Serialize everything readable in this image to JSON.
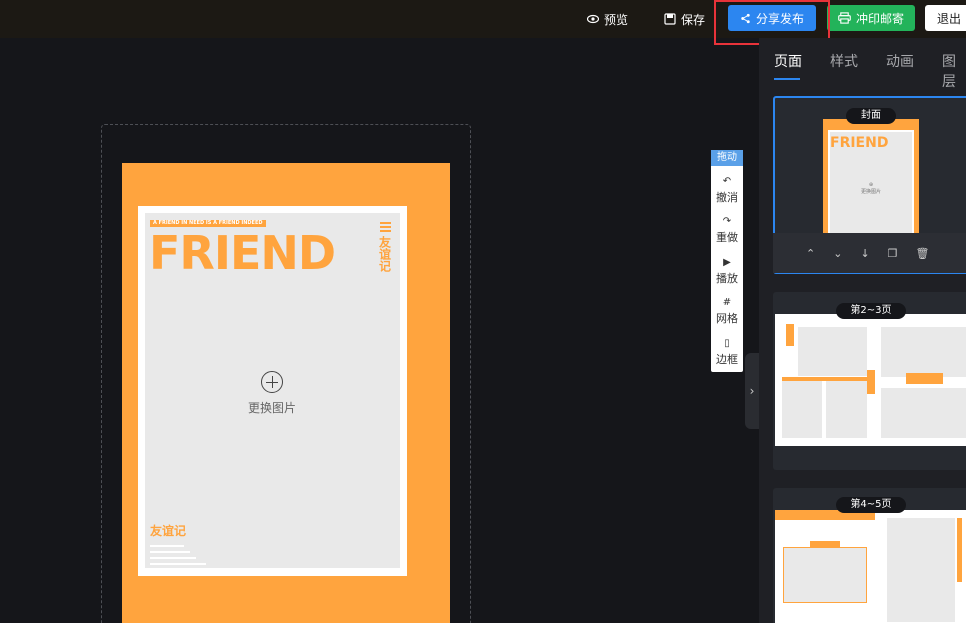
{
  "topbar": {
    "preview_label": "预览",
    "save_label": "保存",
    "share_label": "分享发布",
    "print_label": "冲印邮寄",
    "exit_label": "退出"
  },
  "canvas": {
    "cover_tag": "A FRIEND IN NEED IS A FRIEND INDEED",
    "cover_title": "FRIEND",
    "cover_vertical": "友谊记",
    "replace_image": "更换图片",
    "cover_bottom_title": "友谊记"
  },
  "tools": {
    "drag": "拖动",
    "undo": "撤消",
    "redo": "重做",
    "play": "播放",
    "grid": "网格",
    "border": "边框"
  },
  "panel": {
    "tabs": [
      "页面",
      "样式",
      "动画",
      "图层"
    ],
    "pages": [
      {
        "label": "封面"
      },
      {
        "label": "第2~3页"
      },
      {
        "label": "第4~5页"
      }
    ],
    "mini_replace": "更换图片",
    "mini_title": "FRIEND"
  },
  "colors": {
    "accent_orange": "#ffa43e",
    "share_blue": "#2c86f0",
    "print_green": "#23b35a",
    "highlight_red": "#e8333a"
  }
}
